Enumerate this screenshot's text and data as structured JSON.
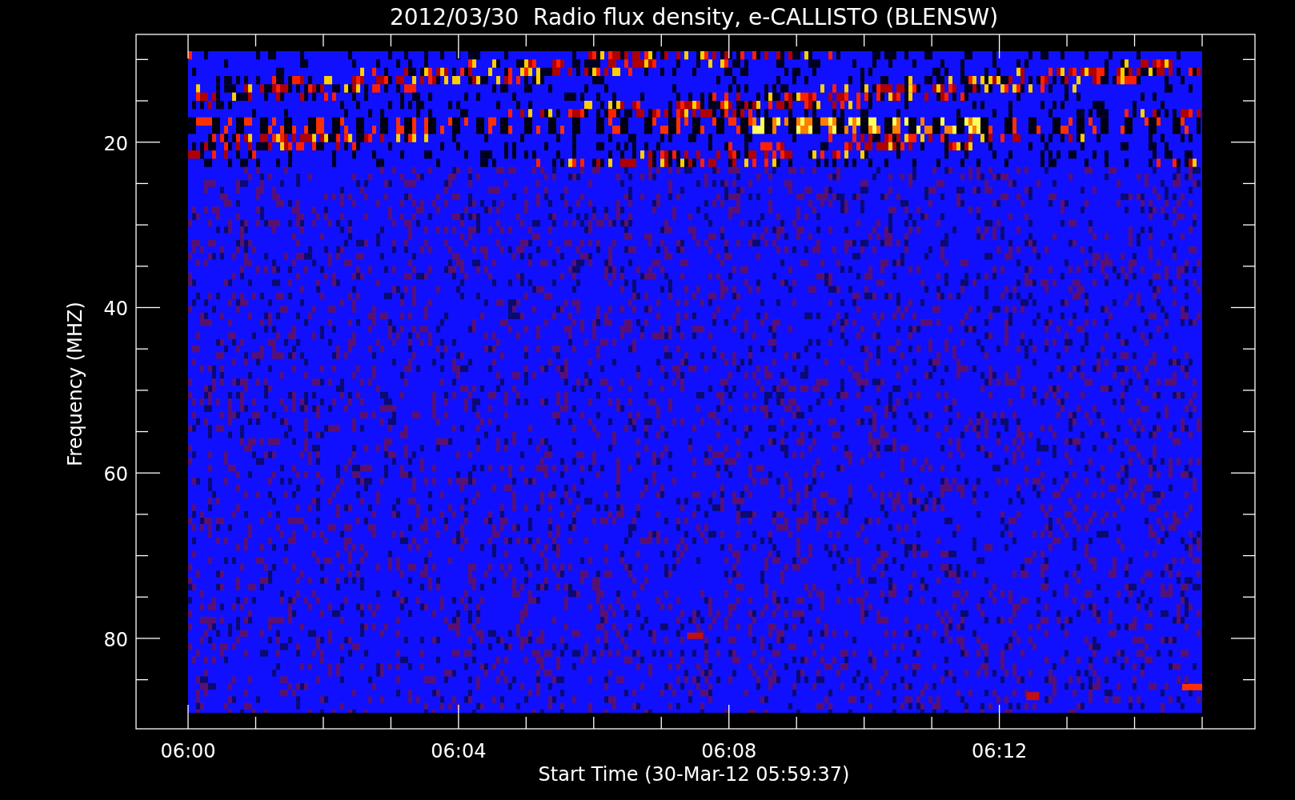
{
  "title": "2012/03/30  Radio flux density, e-CALLISTO (BLENSW)",
  "plot": {
    "ylabel": "Frequency (MHZ)",
    "xlabel": "Start Time (30-Mar-12 05:59:37)",
    "y_tick_labels": [
      "20",
      "40",
      "60",
      "80"
    ],
    "x_tick_labels": [
      "06:00",
      "06:04",
      "06:08",
      "06:12"
    ]
  }
}
